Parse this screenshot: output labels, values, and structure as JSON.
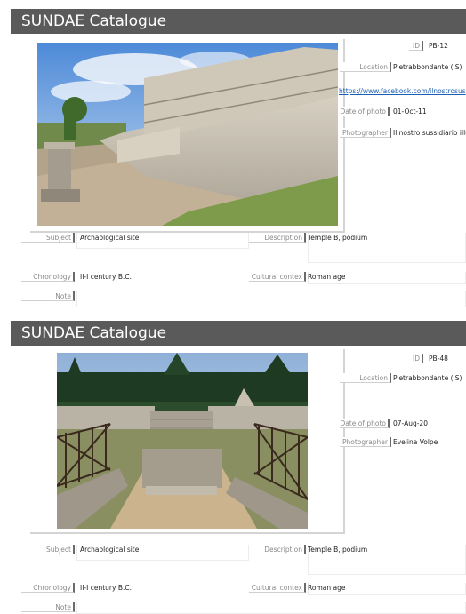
{
  "records": [
    {
      "title": "SUNDAE Catalogue",
      "id_label": "ID",
      "id": "PB-12",
      "location_label": "Location",
      "location": "Pietrabbondante (IS)",
      "link": "https://www.facebook.com/ilnostrosus",
      "date_label": "Date of photo",
      "date": "01-Oct-11",
      "photographer_label": "Photographer",
      "photographer": "Il nostro sussidiario illu",
      "subject_label": "Subject",
      "subject": "Archaological site",
      "description_label": "Description",
      "description": "Temple B, podium",
      "chronology_label": "Chronology",
      "chronology": "II-I century B.C.",
      "context_label": "Cultural contex",
      "context": "Roman age",
      "note_label": "Note",
      "note": ""
    },
    {
      "title": "SUNDAE Catalogue",
      "id_label": "ID",
      "id": "PB-48",
      "location_label": "Location",
      "location": "Pietrabbondante (IS)",
      "link": "",
      "date_label": "Date of photo",
      "date": "07-Aug-20",
      "photographer_label": "Photographer",
      "photographer": "Evelina Volpe",
      "subject_label": "Subject",
      "subject": "Archaological site",
      "description_label": "Description",
      "description": "Temple B, podium",
      "chronology_label": "Chronology",
      "chronology": "II-I century B.C.",
      "context_label": "Cultural contex",
      "context": "Roman age",
      "note_label": "Note",
      "note": ""
    }
  ]
}
